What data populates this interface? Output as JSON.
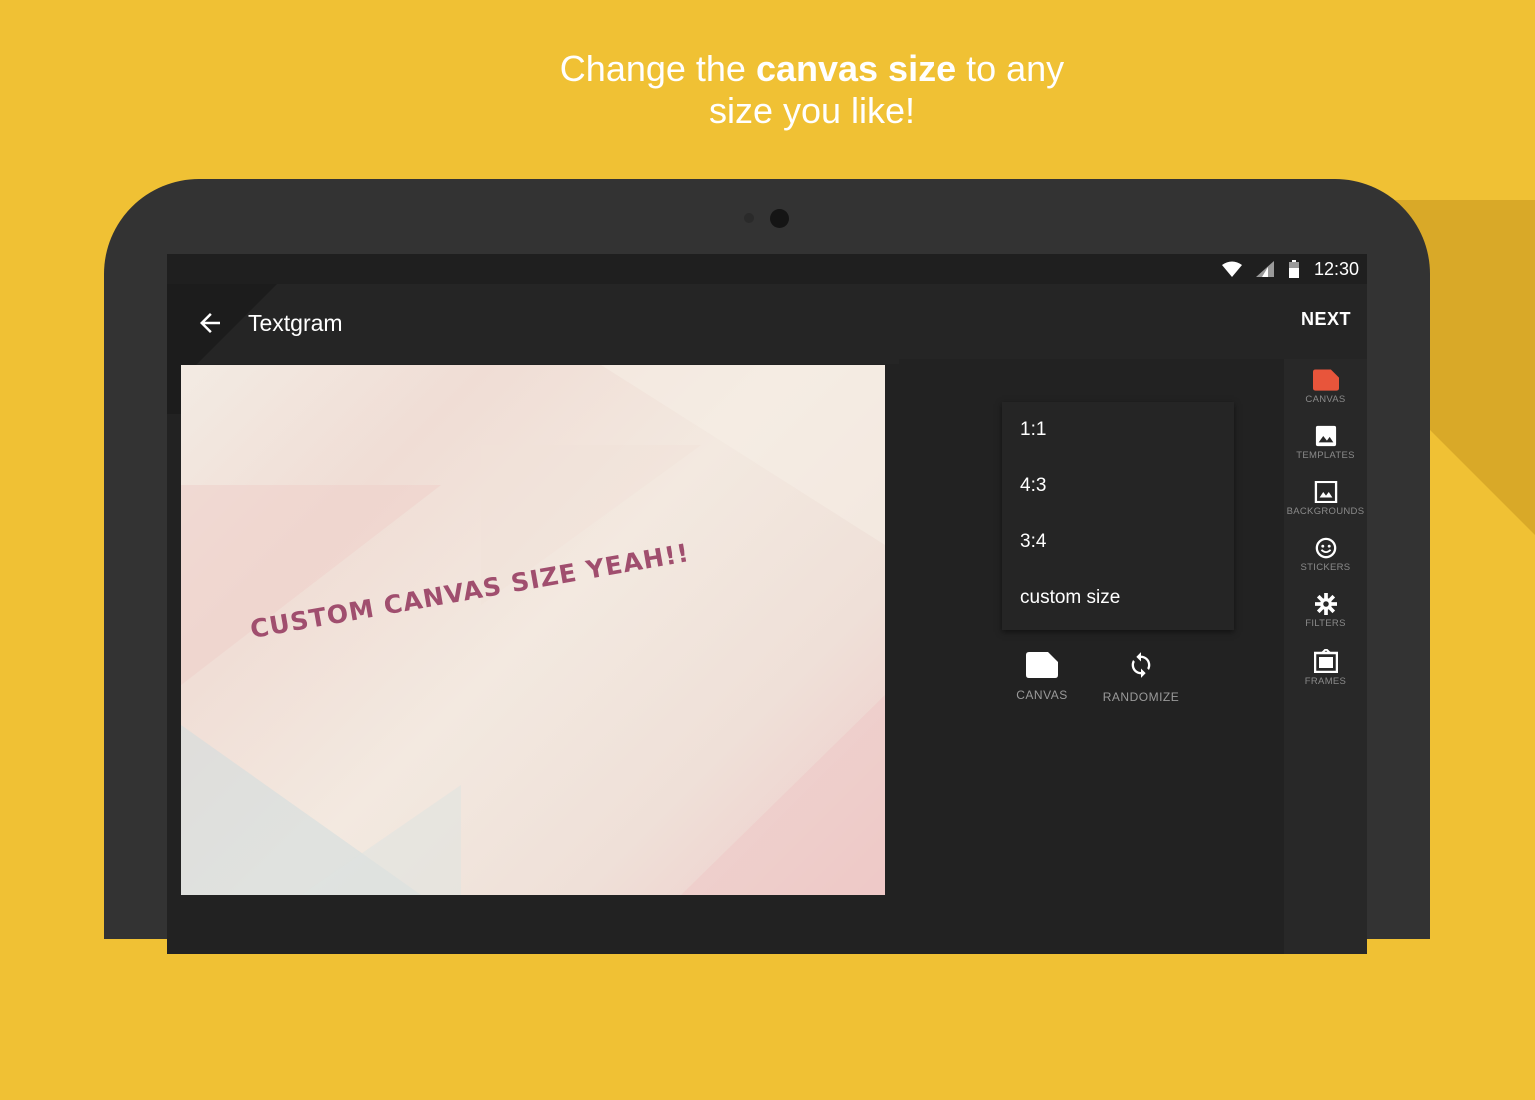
{
  "headline": {
    "line1_pre": "Change the ",
    "line1_bold": "canvas size",
    "line1_post": " to any",
    "line2": "size you like!"
  },
  "status_bar": {
    "time": "12:30",
    "icons": [
      "wifi-icon",
      "signal-icon",
      "battery-icon"
    ]
  },
  "app_bar": {
    "back_icon": "arrow-left-icon",
    "title": "Textgram",
    "next_label": "NEXT"
  },
  "canvas": {
    "text": "CUSTOM CANVAS SIZE YEAH!!"
  },
  "size_menu": {
    "options": [
      "1:1",
      "4:3",
      "3:4",
      "custom size"
    ]
  },
  "tools": [
    {
      "label": "CANVAS",
      "icon": "canvas-icon"
    },
    {
      "label": "RANDOMIZE",
      "icon": "refresh-icon"
    }
  ],
  "side_rail": {
    "items": [
      {
        "label": "CANVAS",
        "icon": "canvas-icon"
      },
      {
        "label": "TEMPLATES",
        "icon": "image-icon"
      },
      {
        "label": "BACKGROUNDS",
        "icon": "background-icon"
      },
      {
        "label": "STICKERS",
        "icon": "smiley-icon"
      },
      {
        "label": "FILTERS",
        "icon": "gear-icon"
      },
      {
        "label": "FRAMES",
        "icon": "frame-icon"
      }
    ]
  },
  "colors": {
    "background": "#F0C134",
    "accent": "#E8553B",
    "canvas_text": "#A04E6E"
  }
}
